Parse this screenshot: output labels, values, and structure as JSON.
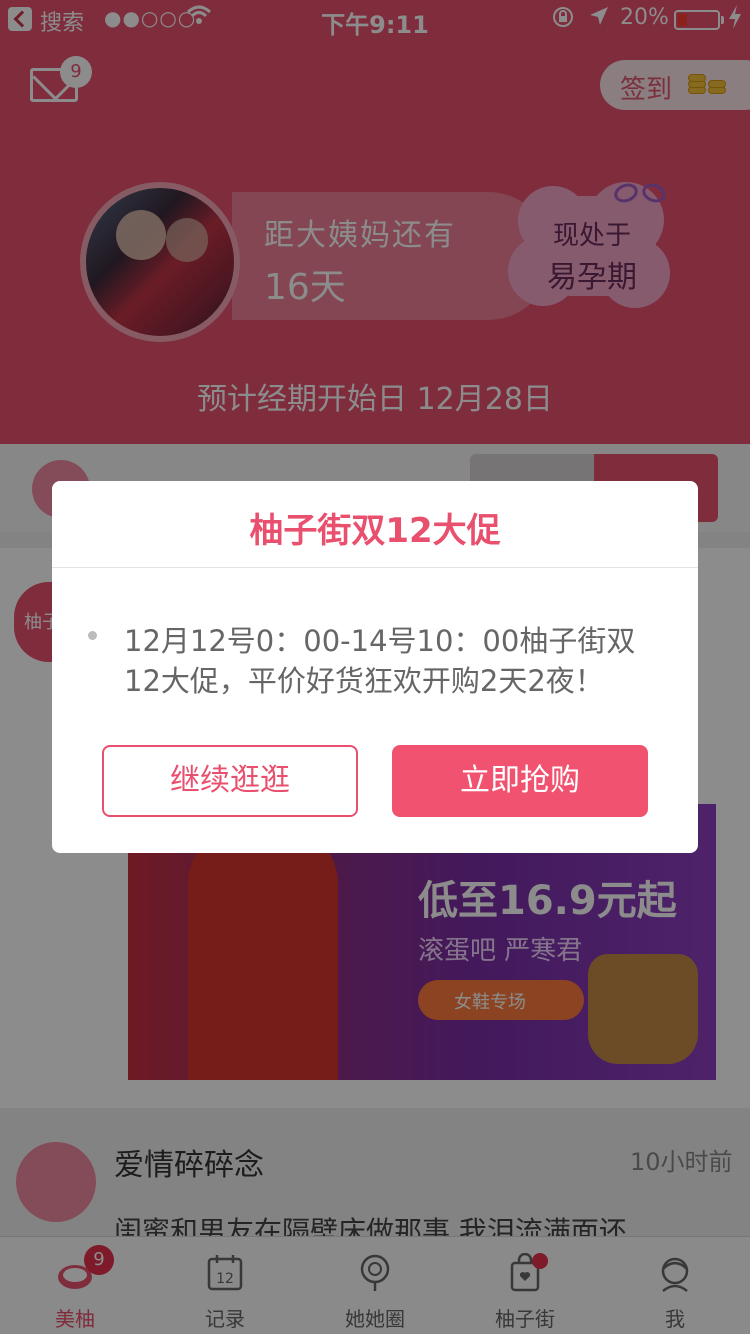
{
  "status_bar": {
    "back_app": "搜索",
    "signal": "●●○○○",
    "time": "下午9:11",
    "battery": "20%"
  },
  "header": {
    "mail_badge": "9",
    "checkin_label": "签到",
    "countdown_label": "距大姨妈还有",
    "countdown_days": "16天",
    "phase_label": "现处于",
    "phase_value": "易孕期",
    "period_date": "预计经期开始日 12月28日"
  },
  "feed": {
    "card_avatar_text": "柚子",
    "ad": {
      "title": "低至16.9元起",
      "subtitle": "滚蛋吧 严寒君",
      "pill": "女鞋专场"
    },
    "post": {
      "title": "爱情碎碎念",
      "time": "10小时前",
      "body": "闺蜜和男友在隔壁床做那事 我泪流满面还"
    }
  },
  "modal": {
    "title": "柚子街双12大促",
    "message": "12月12号0：00-14号10：00柚子街双\n12大促，平价好货狂欢开购2天2夜！",
    "secondary_label": "继续逛逛",
    "primary_label": "立即抢购"
  },
  "tabbar": {
    "tabs": [
      {
        "label": "美柚",
        "badge": "9",
        "active": true
      },
      {
        "label": "记录"
      },
      {
        "label": "她她圈"
      },
      {
        "label": "柚子街",
        "dot": true
      },
      {
        "label": "我"
      }
    ],
    "record_icon_number": "12"
  },
  "colors": {
    "brand": "#e8506e",
    "badge": "#e8304e"
  }
}
